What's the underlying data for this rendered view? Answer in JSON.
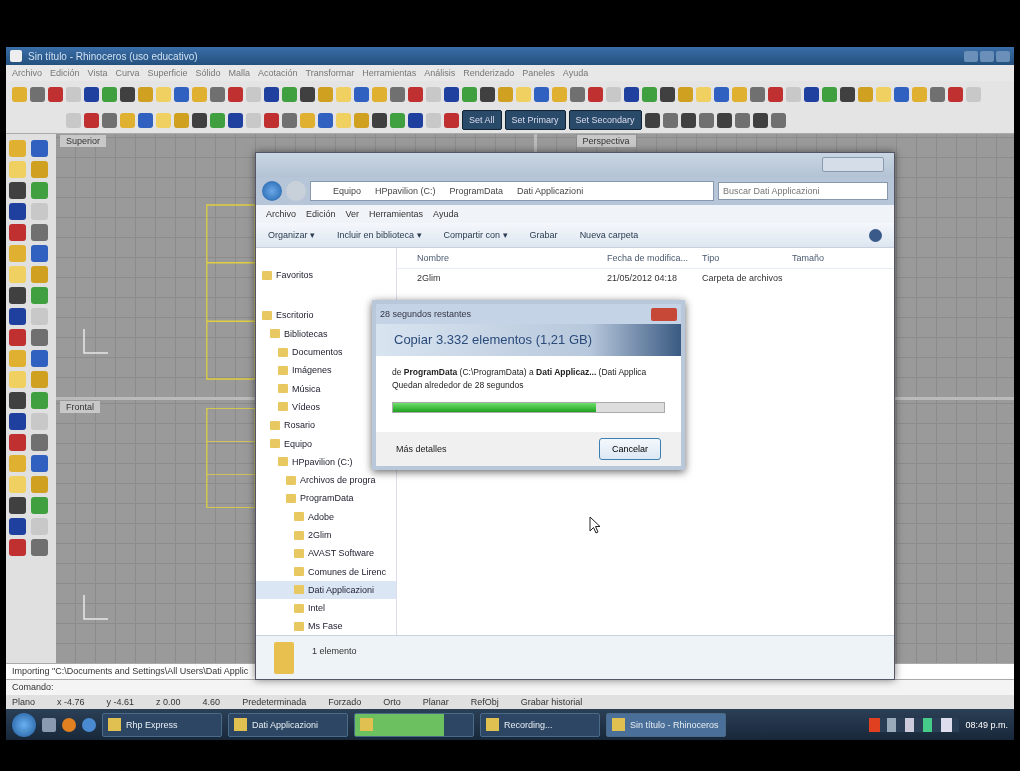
{
  "rhino": {
    "title": "Sin título - Rhinoceros (uso educativo)",
    "menu": [
      "Archivo",
      "Edición",
      "Vista",
      "Curva",
      "Superficie",
      "Sólido",
      "Malla",
      "Acotación",
      "Transformar",
      "Herramientas",
      "Análisis",
      "Renderizado",
      "Paneles",
      "Ayuda"
    ],
    "toolbar_buttons": [
      "Set All",
      "Set Primary",
      "Set Secondary"
    ],
    "viewports": [
      {
        "label": "Superior"
      },
      {
        "label": "Perspectiva"
      },
      {
        "label": "Frontal"
      }
    ],
    "command_history": "Importing \"C:\\Documents and Settings\\All Users\\Dati Applic",
    "command_prompt": "Comando:",
    "status_bar": [
      "Plano",
      "x -4.76",
      "y -4.61",
      "z 0.00",
      "4.60",
      "Predeterminada",
      "Forzado",
      "Orto",
      "Planar",
      "RefObj",
      "Grabar historial"
    ]
  },
  "explorer": {
    "breadcrumb": [
      "Equipo",
      "HPpavilion (C:)",
      "ProgramData",
      "Dati Applicazioni"
    ],
    "search": {
      "placeholder": "Buscar Dati Applicazioni"
    },
    "menu": [
      "Archivo",
      "Edición",
      "Ver",
      "Herramientas",
      "Ayuda"
    ],
    "toolbar": [
      "Organizar ▾",
      "Incluir en biblioteca ▾",
      "Compartir con ▾",
      "Grabar",
      "Nueva carpeta"
    ],
    "columns": [
      "Nombre",
      "Fecha de modifica...",
      "Tipo",
      "Tamaño"
    ],
    "rows": [
      {
        "name": "2Glim",
        "date": "21/05/2012 04:18",
        "type": "Carpeta de archivos"
      }
    ],
    "nav": [
      {
        "label": "Favoritos",
        "selected": false
      },
      {
        "label": "Escritorio",
        "selected": false,
        "children": [
          {
            "label": "Bibliotecas",
            "selected": false,
            "children": [
              {
                "label": "Documentos",
                "selected": false
              },
              {
                "label": "Imágenes",
                "selected": false
              },
              {
                "label": "Música",
                "selected": false
              },
              {
                "label": "Vídeos",
                "selected": false
              }
            ]
          },
          {
            "label": "Rosario",
            "selected": false
          },
          {
            "label": "Equipo",
            "selected": false,
            "children": [
              {
                "label": "HPpavilion (C:)",
                "selected": false,
                "children": [
                  {
                    "label": "Archivos de progra",
                    "selected": false
                  },
                  {
                    "label": "ProgramData",
                    "selected": false,
                    "children": [
                      {
                        "label": "Adobe",
                        "selected": false
                      },
                      {
                        "label": "2Glim",
                        "selected": false
                      },
                      {
                        "label": "AVAST Software",
                        "selected": false
                      },
                      {
                        "label": "Comunes de Lirenc",
                        "selected": false
                      },
                      {
                        "label": "Dati Applicazioni",
                        "selected": true
                      },
                      {
                        "label": "Intel",
                        "selected": false
                      },
                      {
                        "label": "Ms Fase",
                        "selected": false
                      }
                    ]
                  }
                ]
              }
            ]
          }
        ]
      }
    ],
    "details": "1 elemento"
  },
  "dialog": {
    "title": "28 segundos restantes",
    "heading": "Copiar 3.332 elementos (1,21 GB)",
    "from_to": "de **ProgramData** (C:\\ProgramData) a **Dati Applicaz...** (Dati Applica",
    "remaining": "Quedan alrededor de 28 segundos",
    "progress": {
      "level": 0.75
    },
    "details_toggle": "Más detalles",
    "cancel": "Cancelar"
  },
  "taskbar": {
    "tasks": [
      {
        "label": "Rhp Express",
        "selected": false
      },
      {
        "label": "Dati Applicazioni",
        "selected": false
      },
      {
        "selected": false,
        "level": 0.75
      },
      {
        "label": "Recording...",
        "selected": false
      },
      {
        "label": "Sin título - Rhinoceros",
        "selected": true
      }
    ],
    "clock": "08:49 p.m."
  }
}
